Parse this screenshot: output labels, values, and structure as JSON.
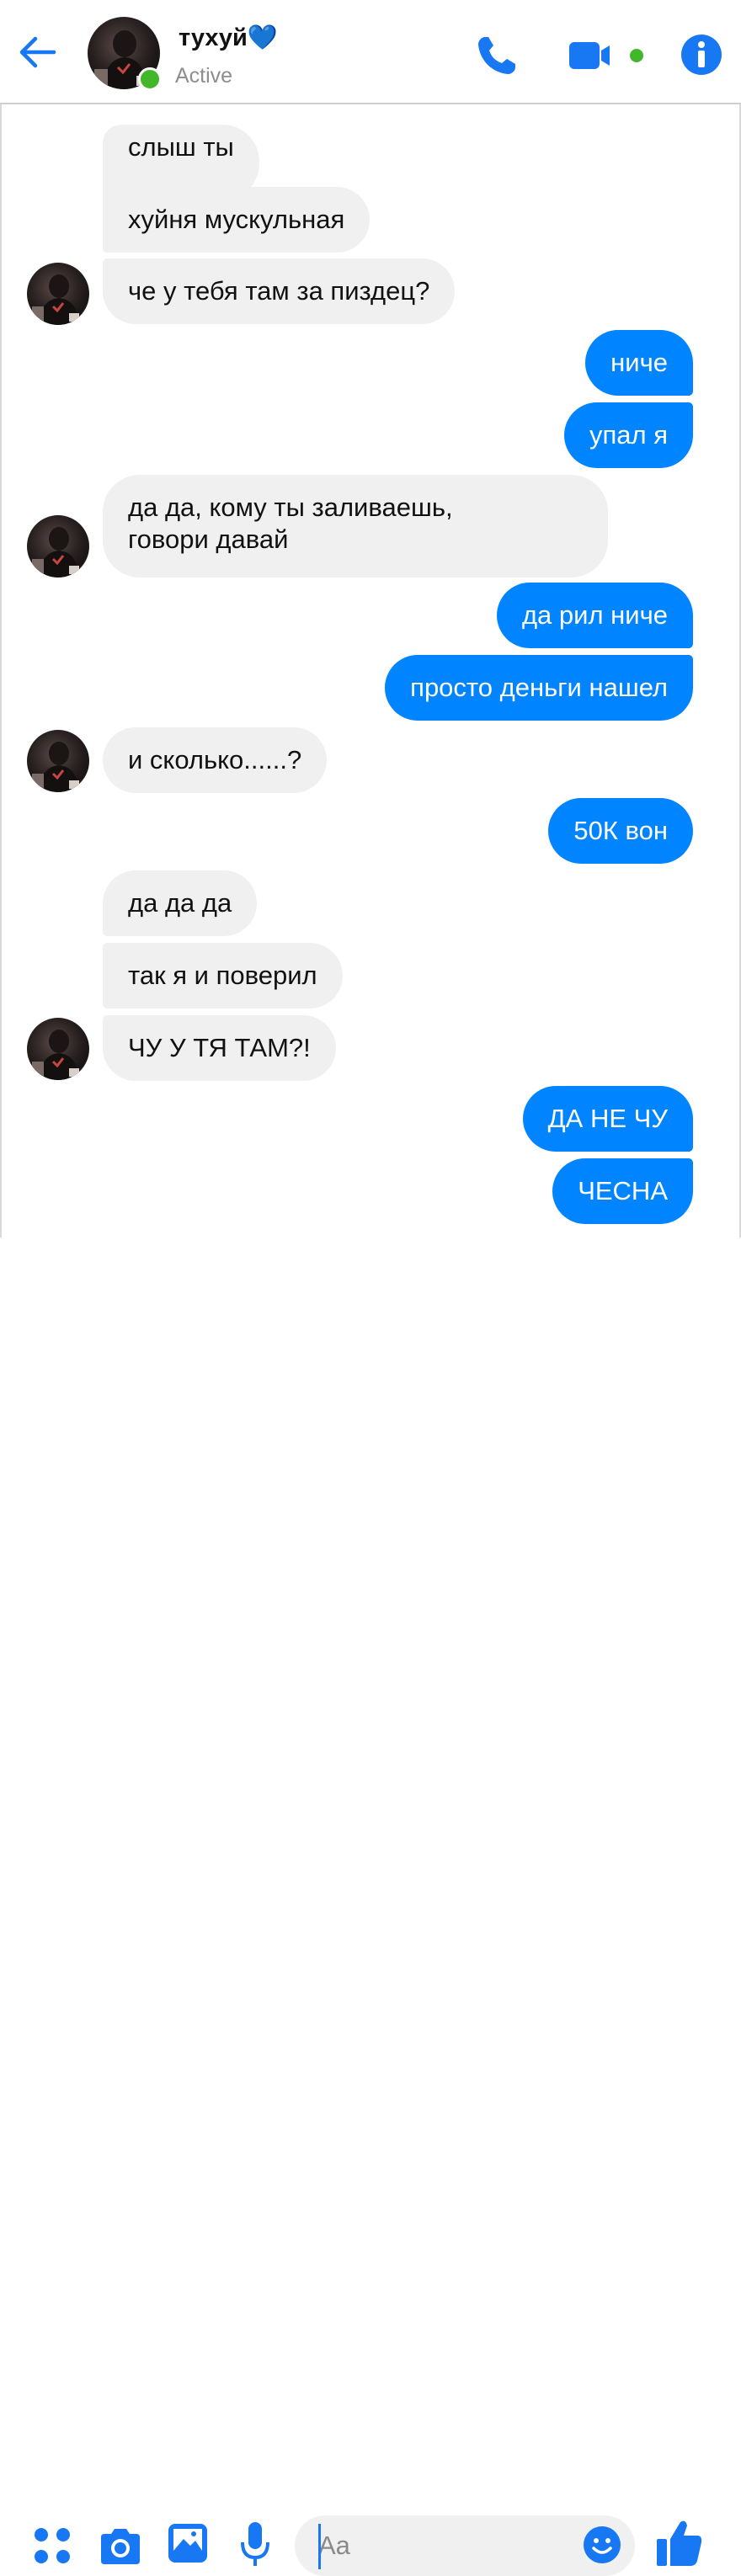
{
  "header": {
    "contact_name": "тухуй",
    "heart": "💙",
    "status": "Active",
    "icons": [
      "back-arrow-icon",
      "phone-icon",
      "video-camera-icon",
      "info-icon"
    ],
    "accent_color": "#1877f2",
    "online_color": "#42b72a"
  },
  "messages": [
    {
      "from": "them",
      "text": "слыш ты"
    },
    {
      "from": "them",
      "text": "хуйня мускульная"
    },
    {
      "from": "them",
      "text": "че у тебя там за пиздец?"
    },
    {
      "from": "me",
      "text": "ниче"
    },
    {
      "from": "me",
      "text": "упал я"
    },
    {
      "from": "them",
      "lines": [
        "да да, кому ты заливаешь,",
        "говори давай"
      ]
    },
    {
      "from": "me",
      "text": "да рил ниче"
    },
    {
      "from": "me",
      "text": "просто деньги нашел"
    },
    {
      "from": "them",
      "text": "и сколько......?"
    },
    {
      "from": "me",
      "text": "50К вон"
    },
    {
      "from": "them",
      "text": "да да да"
    },
    {
      "from": "them",
      "text": "так я и поверил"
    },
    {
      "from": "them",
      "text": "ЧУ У ТЯ ТАМ?!"
    },
    {
      "from": "me",
      "text": "ДА НЕ ЧУ"
    },
    {
      "from": "me",
      "text": "ЧЕСНА"
    }
  ],
  "composer": {
    "placeholder": "Aa",
    "icons": [
      "menu-dots-icon",
      "camera-icon",
      "gallery-icon",
      "microphone-icon",
      "emoji-icon",
      "like-thumb-icon"
    ]
  },
  "colors": {
    "incoming_bubble": "#f0f0f0",
    "outgoing_bubble": "#0084ff"
  }
}
